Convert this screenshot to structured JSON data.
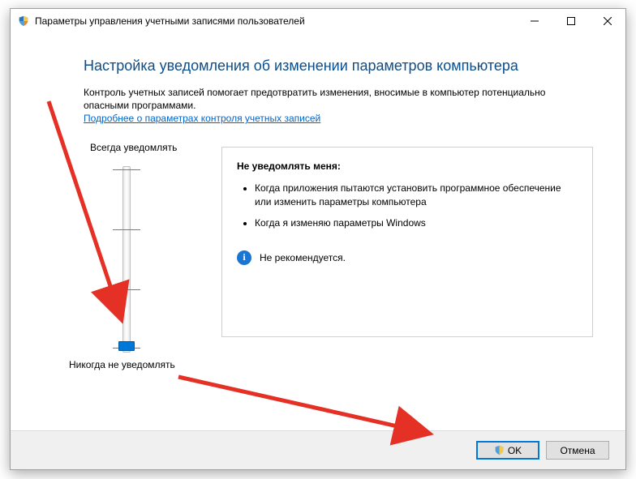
{
  "window": {
    "title": "Параметры управления учетными записями пользователей"
  },
  "heading": "Настройка уведомления об изменении параметров компьютера",
  "intro": "Контроль учетных записей помогает предотвратить изменения, вносимые в компьютер потенциально опасными программами.",
  "link": "Подробнее о параметрах контроля учетных записей",
  "slider": {
    "top_label": "Всегда уведомлять",
    "bottom_label": "Никогда не уведомлять"
  },
  "description": {
    "title": "Не уведомлять меня:",
    "bullets": [
      "Когда приложения пытаются установить программное обеспечение или изменить параметры компьютера",
      "Когда я изменяю параметры Windows"
    ],
    "recommendation": "Не рекомендуется."
  },
  "buttons": {
    "ok": "OK",
    "cancel": "Отмена"
  },
  "controls": {
    "min": "—",
    "max": "☐",
    "close": "✕"
  }
}
